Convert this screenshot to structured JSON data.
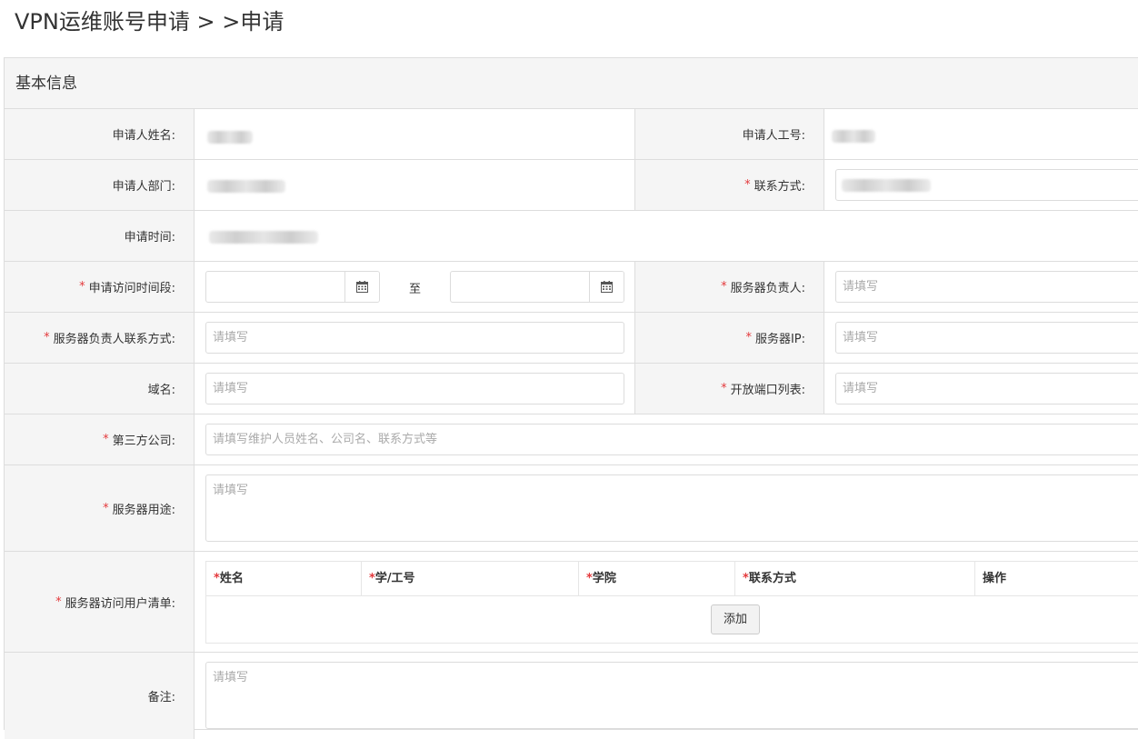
{
  "page": {
    "title": "VPN运维账号申请 > >申请"
  },
  "panel": {
    "heading": "基本信息"
  },
  "form": {
    "applicant_name_label": "申请人姓名:",
    "applicant_id_label": "申请人工号:",
    "applicant_dept_label": "申请人部门:",
    "contact_label": "联系方式:",
    "apply_time_label": "申请时间:",
    "access_period_label": "申请访问时间段:",
    "period_separator": "至",
    "server_owner_label": "服务器负责人:",
    "server_owner_placeholder": "请填写",
    "owner_contact_label": "服务器负责人联系方式:",
    "owner_contact_placeholder": "请填写",
    "server_ip_label": "服务器IP:",
    "server_ip_placeholder": "请填写",
    "domain_label": "域名:",
    "domain_placeholder": "请填写",
    "ports_label": "开放端口列表:",
    "ports_placeholder": "请填写",
    "third_party_label": "第三方公司:",
    "third_party_placeholder": "请填写维护人员姓名、公司名、联系方式等",
    "purpose_label": "服务器用途:",
    "purpose_placeholder": "请填写",
    "user_list_label": "服务器访问用户清单:",
    "remark_label": "备注:",
    "remark_placeholder": "请填写",
    "required_mark": "*"
  },
  "user_table": {
    "columns": [
      "姓名",
      "学/工号",
      "学院",
      "联系方式",
      "操作"
    ],
    "add_button": "添加"
  },
  "icons": {
    "calendar": "calendar-icon"
  },
  "colors": {
    "required": "#e4393c",
    "label_bg": "#f5f5f5",
    "border": "#dddddd"
  }
}
